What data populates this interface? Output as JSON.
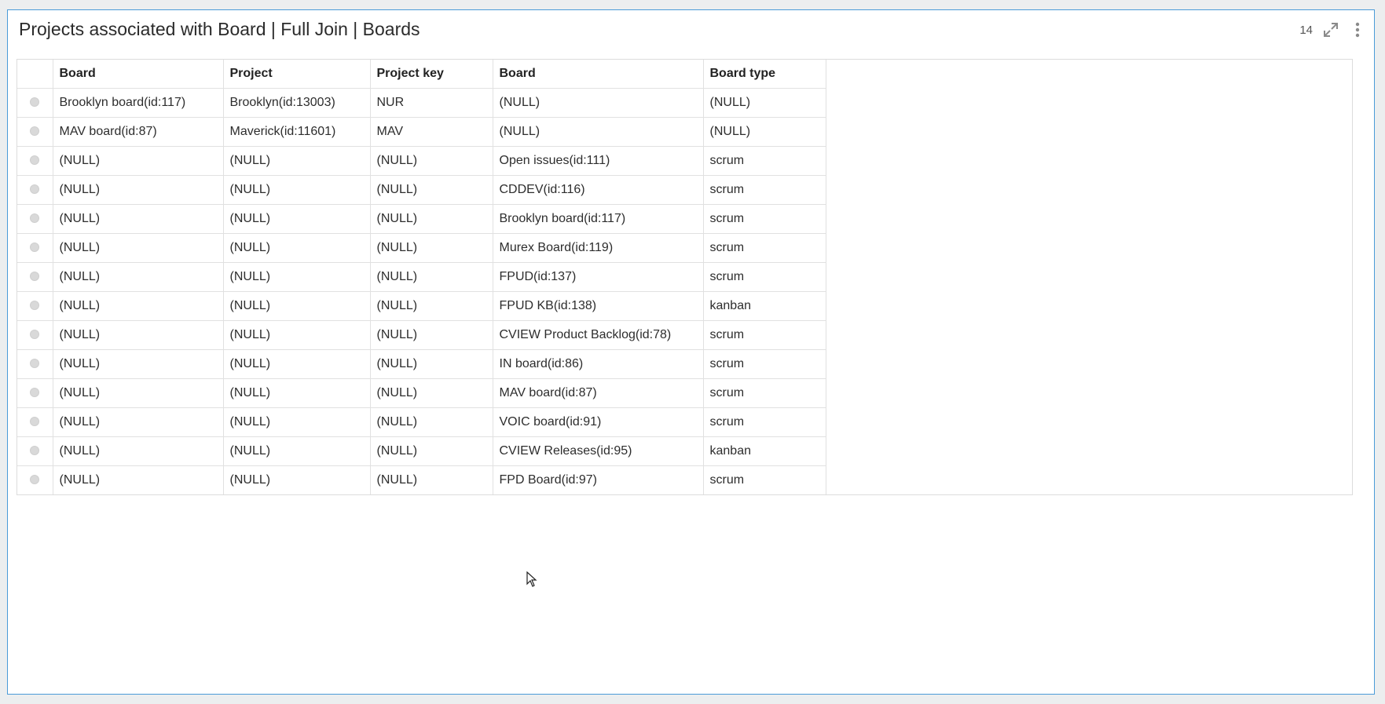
{
  "panel": {
    "title": "Projects associated with Board | Full Join | Boards",
    "row_count": "14",
    "icons": [
      "expand-icon",
      "more-vertical-icon"
    ],
    "accent_color": "#4a9bd8"
  },
  "table": {
    "columns": [
      "Board",
      "Project",
      "Project key",
      "Board",
      "Board type"
    ],
    "rows": [
      [
        "Brooklyn board(id:117)",
        "Brooklyn(id:13003)",
        "NUR",
        "(NULL)",
        "(NULL)"
      ],
      [
        "MAV board(id:87)",
        "Maverick(id:11601)",
        "MAV",
        "(NULL)",
        "(NULL)"
      ],
      [
        "(NULL)",
        "(NULL)",
        "(NULL)",
        "Open issues(id:111)",
        "scrum"
      ],
      [
        "(NULL)",
        "(NULL)",
        "(NULL)",
        "CDDEV(id:116)",
        "scrum"
      ],
      [
        "(NULL)",
        "(NULL)",
        "(NULL)",
        "Brooklyn board(id:117)",
        "scrum"
      ],
      [
        "(NULL)",
        "(NULL)",
        "(NULL)",
        "Murex Board(id:119)",
        "scrum"
      ],
      [
        "(NULL)",
        "(NULL)",
        "(NULL)",
        "FPUD(id:137)",
        "scrum"
      ],
      [
        "(NULL)",
        "(NULL)",
        "(NULL)",
        "FPUD KB(id:138)",
        "kanban"
      ],
      [
        "(NULL)",
        "(NULL)",
        "(NULL)",
        "CVIEW Product Backlog(id:78)",
        "scrum"
      ],
      [
        "(NULL)",
        "(NULL)",
        "(NULL)",
        "IN board(id:86)",
        "scrum"
      ],
      [
        "(NULL)",
        "(NULL)",
        "(NULL)",
        "MAV board(id:87)",
        "scrum"
      ],
      [
        "(NULL)",
        "(NULL)",
        "(NULL)",
        "VOIC board(id:91)",
        "scrum"
      ],
      [
        "(NULL)",
        "(NULL)",
        "(NULL)",
        "CVIEW Releases(id:95)",
        "kanban"
      ],
      [
        "(NULL)",
        "(NULL)",
        "(NULL)",
        "FPD Board(id:97)",
        "scrum"
      ]
    ]
  }
}
